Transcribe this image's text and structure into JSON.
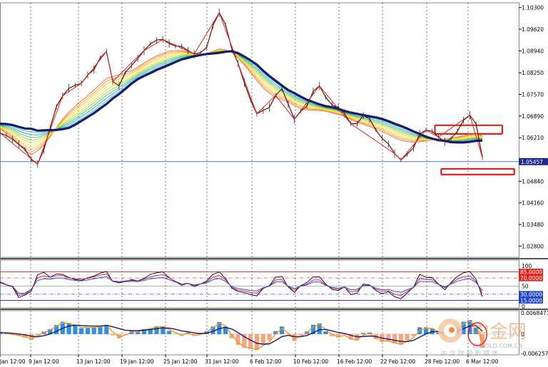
{
  "chart_data": {
    "type": "line",
    "price_ticks": [
      "1.10300",
      "1.09620",
      "1.08940",
      "1.08250",
      "1.07570",
      "1.06890",
      "1.06210",
      "1.05457",
      "1.04840",
      "1.04160",
      "1.03480",
      "1.02800"
    ],
    "price_range": [
      1.0245,
      1.1045
    ],
    "current_price": "1.05457",
    "x_labels": [
      "Jan 12:00",
      "9 Jan 12:00",
      "13 Jan 12:00",
      "19 Jan 12:00",
      "25 Jan 12:00",
      "31 Jan 12:00",
      "6 Feb 12:00",
      "10 Feb 12:00",
      "16 Feb 12:00",
      "22 Feb 12:00",
      "28 Feb 12:00",
      "6 Mar 12:00"
    ],
    "series": [
      {
        "values": [
          1.0636,
          1.0628,
          1.0616,
          1.06,
          1.0585,
          1.0552,
          1.0538,
          1.0584,
          1.0652,
          1.0718,
          1.0753,
          1.0776,
          1.0786,
          1.0792,
          1.0818,
          1.0835,
          1.0872,
          1.0892,
          1.0798,
          1.0784,
          1.0826,
          1.0848,
          1.087,
          1.0895,
          1.0916,
          1.0928,
          1.093,
          1.0917,
          1.0909,
          1.0908,
          1.0895,
          1.0884,
          1.0888,
          1.0905,
          1.0974,
          1.1014,
          1.0977,
          1.0901,
          1.0855,
          1.0794,
          1.0739,
          1.0696,
          1.0707,
          1.0716,
          1.0754,
          1.0775,
          1.0727,
          1.0679,
          1.0704,
          1.0721,
          1.0767,
          1.0784,
          1.0748,
          1.0724,
          1.0716,
          1.0697,
          1.0665,
          1.0665,
          1.0691,
          1.068,
          1.0645,
          1.0619,
          1.0601,
          1.0571,
          1.0551,
          1.0569,
          1.0589,
          1.0633,
          1.0645,
          1.0641,
          1.0623,
          1.0608,
          1.0618,
          1.0641,
          1.0676,
          1.0692,
          1.0664,
          1.0559
        ]
      },
      {
        "values": [
          1.0649,
          1.0635,
          1.0621,
          1.06,
          1.0581,
          1.0567,
          1.0581,
          1.0598,
          1.0624,
          1.0653,
          1.0679,
          1.0702,
          1.072,
          1.0737,
          1.0753,
          1.0771,
          1.0789,
          1.0807,
          1.0813,
          1.0819,
          1.0826,
          1.0832,
          1.0843,
          1.0856,
          1.0868,
          1.0878,
          1.0886,
          1.0893,
          1.0895,
          1.0895,
          1.0891,
          1.0885,
          1.0883,
          1.0886,
          1.0893,
          1.09,
          1.0898,
          1.0888,
          1.0872,
          1.085,
          1.0825,
          1.0801,
          1.0778,
          1.0761,
          1.0748,
          1.0741,
          1.0733,
          1.0722,
          1.0713,
          1.0708,
          1.0707,
          1.0707,
          1.0704,
          1.0699,
          1.0694,
          1.0688,
          1.0679,
          1.067,
          1.0663,
          1.0656,
          1.0648,
          1.064,
          1.0631,
          1.0621,
          1.0613,
          1.0609,
          1.0607,
          1.0608,
          1.0611,
          1.0614,
          1.0616,
          1.0617,
          1.062,
          1.0623,
          1.0627,
          1.0632,
          1.0635,
          1.0627
        ]
      },
      {
        "values": [
          1.0665,
          1.0664,
          1.0661,
          1.0655,
          1.065,
          1.0649,
          1.0643,
          1.0644,
          1.0645,
          1.0645,
          1.0648,
          1.0652,
          1.0662,
          1.0674,
          1.0686,
          1.0698,
          1.0713,
          1.0727,
          1.0744,
          1.0758,
          1.0774,
          1.0791,
          1.0805,
          1.0815,
          1.0824,
          1.0834,
          1.0842,
          1.085,
          1.0859,
          1.0867,
          1.0872,
          1.0877,
          1.0881,
          1.0884,
          1.0886,
          1.0888,
          1.0891,
          1.0893,
          1.0887,
          1.0876,
          1.0864,
          1.0851,
          1.0832,
          1.0815,
          1.08,
          1.0785,
          1.0771,
          1.0761,
          1.075,
          1.074,
          1.0733,
          1.0726,
          1.072,
          1.0717,
          1.0712,
          1.0705,
          1.07,
          1.0696,
          1.0692,
          1.0688,
          1.0685,
          1.068,
          1.0673,
          1.0665,
          1.0658,
          1.065,
          1.0641,
          1.0633,
          1.0624,
          1.0618,
          1.0613,
          1.0611,
          1.0607,
          1.0606,
          1.0606,
          1.0608,
          1.0611,
          1.0612
        ]
      }
    ],
    "indicator1_ticks": [
      "100",
      "85.0000",
      "70.0000",
      "50",
      "30.0000",
      "15.0000",
      "0"
    ],
    "indicator1_levels": [
      85,
      70,
      50,
      30,
      15
    ],
    "indicator1_series": [
      {
        "values": [
          60,
          53,
          48,
          22,
          28,
          38,
          78,
          84,
          72,
          80,
          79,
          71,
          66,
          64,
          70,
          75,
          82,
          86,
          62,
          58,
          61,
          66,
          63,
          69,
          79,
          83,
          85,
          71,
          61,
          52,
          57,
          49,
          55,
          63,
          79,
          85,
          69,
          45,
          37,
          34,
          29,
          26,
          44,
          51,
          72,
          74,
          48,
          35,
          51,
          59,
          73,
          73,
          55,
          42,
          39,
          48,
          29,
          33,
          55,
          53,
          39,
          31,
          36,
          24,
          19,
          33,
          47,
          79,
          72,
          71,
          55,
          41,
          59,
          74,
          83,
          86,
          67,
          24
        ]
      },
      {
        "values": [
          61,
          54,
          49,
          27,
          30,
          42,
          71,
          75,
          72,
          76,
          76,
          70,
          68,
          67,
          69,
          73,
          77,
          80,
          63,
          61,
          63,
          64,
          63,
          67,
          73,
          76,
          78,
          70,
          62,
          55,
          57,
          52,
          55,
          60,
          72,
          76,
          66,
          47,
          40,
          38,
          34,
          33,
          45,
          50,
          65,
          66,
          49,
          40,
          50,
          55,
          65,
          65,
          53,
          45,
          42,
          47,
          36,
          38,
          52,
          52,
          42,
          37,
          38,
          30,
          27,
          37,
          46,
          69,
          66,
          66,
          55,
          46,
          57,
          67,
          73,
          75,
          62,
          32
        ]
      },
      {
        "values": [
          58,
          53,
          50,
          32,
          33,
          42,
          64,
          68,
          67,
          70,
          70,
          66,
          64,
          63,
          65,
          68,
          71,
          73,
          62,
          60,
          61,
          62,
          61,
          64,
          68,
          70,
          71,
          66,
          60,
          55,
          56,
          53,
          55,
          58,
          66,
          69,
          62,
          49,
          44,
          42,
          39,
          38,
          46,
          50,
          60,
          61,
          50,
          44,
          50,
          53,
          60,
          60,
          52,
          47,
          45,
          48,
          41,
          42,
          51,
          51,
          45,
          41,
          42,
          37,
          35,
          41,
          47,
          62,
          61,
          61,
          54,
          48,
          55,
          62,
          66,
          68,
          59,
          39
        ]
      }
    ],
    "indicator2_ticks": [
      "0.0068477",
      "0",
      "-0.0062577"
    ],
    "indicator2_range": [
      -0.0062577,
      0.0068477
    ],
    "indicator2_histogram": [
      0.00066,
      0.00012,
      -0.00023,
      -0.00064,
      -0.00112,
      -0.00186,
      -0.00048,
      0.00078,
      0.00159,
      0.00295,
      0.00397,
      0.0035,
      0.00269,
      0.0019,
      0.00194,
      0.00211,
      0.00234,
      0.00296,
      -0.00042,
      -0.00144,
      -0.00015,
      0.00113,
      0.00072,
      0.00163,
      0.00183,
      0.00253,
      0.00249,
      0.00102,
      5e-05,
      -0.00061,
      0.00053,
      -0.0006,
      -7e-05,
      0.00098,
      0.00245,
      0.00389,
      0.00242,
      -0.00135,
      -0.00348,
      -0.00448,
      -0.00476,
      -0.00508,
      -0.00318,
      -0.00213,
      0.00093,
      0.00244,
      -0.00013,
      -0.00229,
      -0.00041,
      0.00084,
      0.00297,
      0.00343,
      0.00091,
      -0.00065,
      -0.00114,
      -0.00018,
      -0.00179,
      -0.00207,
      0.00031,
      0.00051,
      -0.00162,
      -0.00256,
      -0.0023,
      -0.00302,
      -0.00345,
      -0.00202,
      -0.00067,
      0.0022,
      0.00218,
      0.00178,
      0.0004,
      -0.00094,
      0.0004,
      0.0023,
      0.00397,
      0.00451,
      0.00209,
      -0.0044
    ],
    "indicator2_lines": [
      {
        "values": [
          0.00058,
          0.00022,
          -0.00011,
          -0.00046,
          -0.00089,
          -0.0015,
          -0.00075,
          0.00054,
          0.00134,
          0.00254,
          0.00358,
          0.00348,
          0.00294,
          0.00219,
          0.00209,
          0.00216,
          0.00232,
          0.00279,
          0.00073,
          -0.00083,
          -0.00035,
          0.00069,
          0.00072,
          0.00141,
          0.00172,
          0.0023,
          0.00243,
          0.00142,
          0.00047,
          -0.00035,
          0.00025,
          -0.0004,
          -0.00017,
          0.00068,
          0.00202,
          0.00345,
          0.00273,
          -0.00032,
          -0.00266,
          -0.00403,
          -0.00457,
          -0.00496,
          -0.00372,
          -0.00259,
          3e-05,
          0.00181,
          0.00037,
          -0.00153,
          -0.00072,
          0.00039,
          0.00235,
          0.00311,
          0.00144,
          -0.00013,
          -0.00092,
          -0.00041,
          -0.00151,
          -0.00189,
          -0.00035,
          0.0002,
          -0.00111,
          -0.00214,
          -0.00225,
          -0.00279,
          -0.00326,
          -0.00239,
          -0.00118,
          0.0012,
          0.00183,
          0.00178,
          0.00077,
          -0.00048,
          0.00012,
          0.00174,
          0.00329,
          0.00419,
          0.00268,
          -0.00257
        ]
      },
      {
        "values": [
          0.00048,
          0.00039,
          0.00025,
          3e-05,
          -0.00025,
          -0.00066,
          -0.00087,
          -0.00053,
          4e-05,
          0.00087,
          0.00187,
          0.00258,
          0.00287,
          0.00278,
          0.00263,
          0.00257,
          0.00262,
          0.00281,
          0.00235,
          0.00176,
          0.00124,
          0.00114,
          0.00111,
          0.00127,
          0.00147,
          0.00175,
          0.00199,
          0.00191,
          0.00157,
          0.00104,
          0.00077,
          0.00036,
          0.00017,
          0.00032,
          0.00087,
          0.00174,
          0.00217,
          0.00162,
          0.00049,
          -0.00085,
          -0.00199,
          -0.00297,
          -0.00326,
          -0.00318,
          -0.00208,
          -0.00082,
          -0.00041,
          -0.00081,
          -0.00083,
          -0.00047,
          0.00044,
          0.00138,
          0.00151,
          0.00103,
          0.00053,
          0.00021,
          -0.00039,
          -0.00086,
          -0.00078,
          -0.00062,
          -0.00078,
          -0.00126,
          -0.00164,
          -0.00203,
          -0.00238,
          -0.00242,
          -0.00206,
          -0.00098,
          3e-05,
          0.00075,
          0.00077,
          0.00038,
          0.00031,
          0.00087,
          0.00175,
          0.00265,
          0.00274,
          0.00093
        ]
      }
    ],
    "highlight_boxes": [
      {
        "price_top": 1.066,
        "price_bottom": 1.0633,
        "from_index": 70,
        "to_index": 77
      },
      {
        "price_top": 1.0523,
        "price_bottom": 1.0505,
        "from_index": 71,
        "to_index": 78
      }
    ],
    "watermark": {
      "brand": "中金网",
      "domain": "CNGOLD.COM.CN",
      "tagline": "中 文 财 经 新 媒 体"
    }
  }
}
